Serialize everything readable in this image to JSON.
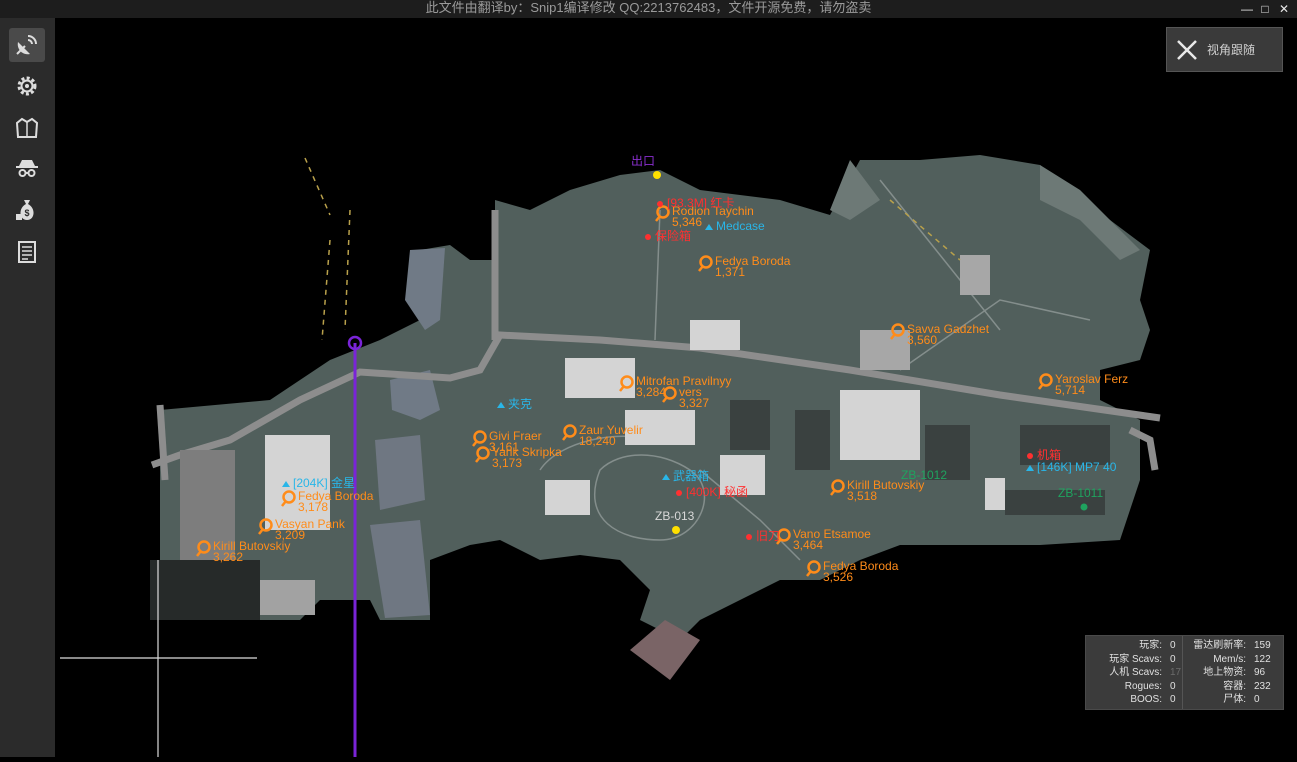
{
  "window": {
    "title": "此文件由翻译by：Snip1编译修改 QQ:2213762483，文件开源免费，请勿盗卖",
    "controls": {
      "minimize": "—",
      "maximize": "□",
      "close": "✕"
    }
  },
  "sidebar": {
    "items": [
      {
        "icon": "radar-icon"
      },
      {
        "icon": "gear-icon"
      },
      {
        "icon": "jacket-icon"
      },
      {
        "icon": "spy-icon"
      },
      {
        "icon": "money-bag-icon"
      },
      {
        "icon": "list-icon"
      }
    ]
  },
  "follow_button": {
    "label": "视角跟随",
    "icon": "close-icon"
  },
  "map": {
    "players": [
      {
        "name": "Rodion Taychin",
        "dist": "5,346"
      },
      {
        "name": "Fedya Boroda",
        "dist": "1,371"
      },
      {
        "name": "Savva Gadzhet",
        "dist": "3,560"
      },
      {
        "name": "Yaroslav Ferz",
        "dist": "5,714"
      },
      {
        "name": "Mitrofan Pravilnyy",
        "dist": "3,284"
      },
      {
        "name": "vers",
        "dist": "3,327"
      },
      {
        "name": "Givi Fraer",
        "dist": "3,161"
      },
      {
        "name": "Zaur Yuvelir",
        "dist": "18,240"
      },
      {
        "name": "Yarik Skripka",
        "dist": "3,173"
      },
      {
        "name": "Fedya Boroda",
        "dist": "3,178"
      },
      {
        "name": "Vasyan Pank",
        "dist": "3,209"
      },
      {
        "name": "Kirill Butovskiy",
        "dist": "3,262"
      },
      {
        "name": "Kirill Butovskiy",
        "dist": "3,518"
      },
      {
        "name": "Vano Etsamoe",
        "dist": "3,464"
      },
      {
        "name": "Fedya Boroda",
        "dist": "3,526"
      }
    ],
    "loot": [
      {
        "label": "[93.3M] 红卡"
      },
      {
        "label": "Medcase"
      },
      {
        "label": "保险箱"
      },
      {
        "label": "夹克"
      },
      {
        "label": "[204K] 金星"
      },
      {
        "label": "武器箱"
      },
      {
        "label": "[400K] 秘函"
      },
      {
        "label": "旧刀"
      },
      {
        "label": "机箱"
      },
      {
        "label": "[146K] MP7 40"
      }
    ],
    "extracts": [
      {
        "label": "ZB-1012"
      },
      {
        "label": "ZB-1011"
      },
      {
        "label": "ZB-013"
      },
      {
        "label": "出口"
      }
    ]
  },
  "stats": {
    "left": [
      {
        "k": "玩家:",
        "v": "0"
      },
      {
        "k": "玩家 Scavs:",
        "v": "0"
      },
      {
        "k": "人机 Scavs:",
        "v": "17"
      },
      {
        "k": "Rogues:",
        "v": "0"
      },
      {
        "k": "BOOS:",
        "v": "0"
      }
    ],
    "right": [
      {
        "k": "雷达刷新率:",
        "v": "159"
      },
      {
        "k": "Mem/s:",
        "v": "122"
      },
      {
        "k": "地上物资:",
        "v": "96"
      },
      {
        "k": "容器:",
        "v": "232"
      },
      {
        "k": "尸体:",
        "v": "0"
      }
    ]
  },
  "colors": {
    "player": "#ff8c1a",
    "loot": "#29b6e8",
    "loot_valuable": "#ff3030",
    "extract": "#1fa35f",
    "quest": "#ffe000",
    "self_line": "#7a24d8",
    "map_fill": "#515f5c",
    "road": "#8d8d8d"
  }
}
